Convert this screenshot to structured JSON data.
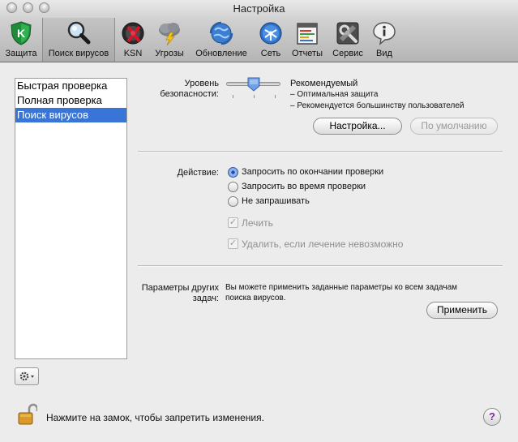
{
  "window": {
    "title": "Настройка"
  },
  "toolbar": {
    "items": [
      {
        "label": "Защита",
        "icon": "shield-k-icon"
      },
      {
        "label": "Поиск вирусов",
        "icon": "magnifier-icon",
        "selected": true
      },
      {
        "label": "KSN",
        "icon": "ksn-icon"
      },
      {
        "label": "Угрозы",
        "icon": "storm-cloud-icon"
      },
      {
        "label": "Обновление",
        "icon": "update-globe-icon"
      },
      {
        "label": "Сеть",
        "icon": "network-icon"
      },
      {
        "label": "Отчеты",
        "icon": "report-icon"
      },
      {
        "label": "Сервис",
        "icon": "service-tools-icon"
      },
      {
        "label": "Вид",
        "icon": "view-bubble-icon"
      }
    ]
  },
  "tasks": {
    "items": [
      {
        "label": "Быстрая проверка"
      },
      {
        "label": "Полная проверка"
      },
      {
        "label": "Поиск вирусов",
        "selected": true
      }
    ]
  },
  "security": {
    "label_line1": "Уровень",
    "label_line2": "безопасности:",
    "level": "Рекомендуемый",
    "desc1": "– Оптимальная защита",
    "desc2": "– Рекомендуется большинству пользователей",
    "settings_button": "Настройка...",
    "default_button": "По умолчанию"
  },
  "action": {
    "label": "Действие:",
    "options": [
      {
        "label": "Запросить по окончании проверки",
        "selected": true
      },
      {
        "label": "Запросить во время проверки",
        "selected": false
      },
      {
        "label": "Не запрашивать",
        "selected": false
      }
    ],
    "cure_label": "Лечить",
    "delete_label": "Удалить, если лечение невозможно"
  },
  "other": {
    "label_line1": "Параметры других",
    "label_line2": "задач:",
    "text_line1": "Вы можете применить заданные параметры ко всем задачам",
    "text_line2": "поиска вирусов.",
    "apply_button": "Применить"
  },
  "footer": {
    "lock_text": "Нажмите на замок, чтобы запретить изменения.",
    "help": "?"
  }
}
